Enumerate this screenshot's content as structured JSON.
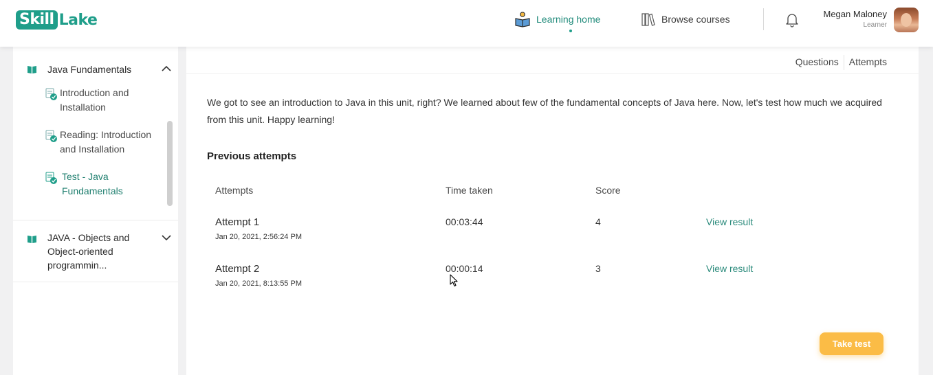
{
  "brand": {
    "part1": "Skill",
    "part2": "Lake",
    "color": "#1f9e8a"
  },
  "nav": {
    "learning_home": "Learning home",
    "browse_courses": "Browse courses"
  },
  "user": {
    "name": "Megan Maloney",
    "role": "Learner"
  },
  "sidebar": {
    "modules": [
      {
        "title": "Java Fundamentals",
        "expanded": true,
        "lessons": [
          {
            "label": "Introduction and Installation",
            "icon": "lesson-check-icon",
            "active": false
          },
          {
            "label": "Reading: Introduction and Installation",
            "icon": "reading-check-icon",
            "active": false
          },
          {
            "label": "Test - Java Fundamentals",
            "icon": "test-check-icon",
            "active": true
          }
        ]
      },
      {
        "title": "JAVA - Objects and Object-oriented programmin...",
        "expanded": false,
        "lessons": []
      }
    ]
  },
  "main": {
    "tabs": [
      "Questions",
      "Attempts"
    ],
    "intro": "We got to see an introduction to Java in this unit, right? We learned about few of the fundamental concepts of Java here. Now, let's test how much we acquired from this unit. Happy learning!",
    "section_title": "Previous attempts",
    "table": {
      "headers": [
        "Attempts",
        "Time taken",
        "Score"
      ],
      "rows": [
        {
          "attempt": "Attempt 1",
          "date": "Jan 20, 2021, 2:56:24 PM",
          "time": "00:03:44",
          "score": "4",
          "action": "View result"
        },
        {
          "attempt": "Attempt 2",
          "date": "Jan 20, 2021, 8:13:55 PM",
          "time": "00:00:14",
          "score": "3",
          "action": "View result"
        }
      ]
    },
    "take_test": "Take test"
  },
  "colors": {
    "accent": "#1f9e8a",
    "button": "#fbbc46",
    "link": "#2a8a7b"
  }
}
